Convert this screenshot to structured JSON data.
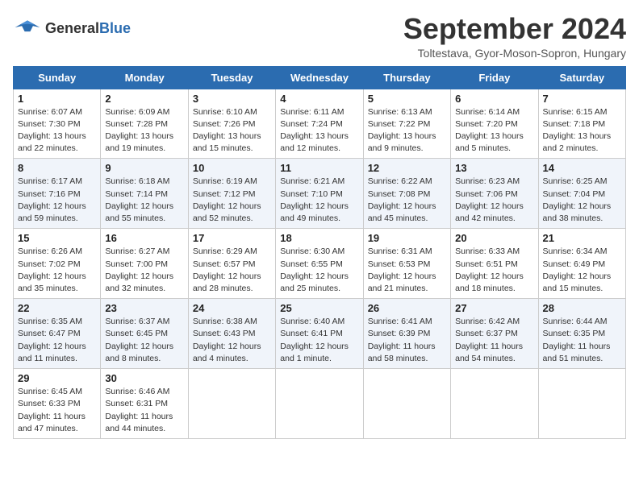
{
  "header": {
    "logo_general": "General",
    "logo_blue": "Blue",
    "month": "September 2024",
    "location": "Toltestava, Gyor-Moson-Sopron, Hungary"
  },
  "weekdays": [
    "Sunday",
    "Monday",
    "Tuesday",
    "Wednesday",
    "Thursday",
    "Friday",
    "Saturday"
  ],
  "weeks": [
    [
      {
        "day": "1",
        "sunrise": "Sunrise: 6:07 AM",
        "sunset": "Sunset: 7:30 PM",
        "daylight": "Daylight: 13 hours and 22 minutes."
      },
      {
        "day": "2",
        "sunrise": "Sunrise: 6:09 AM",
        "sunset": "Sunset: 7:28 PM",
        "daylight": "Daylight: 13 hours and 19 minutes."
      },
      {
        "day": "3",
        "sunrise": "Sunrise: 6:10 AM",
        "sunset": "Sunset: 7:26 PM",
        "daylight": "Daylight: 13 hours and 15 minutes."
      },
      {
        "day": "4",
        "sunrise": "Sunrise: 6:11 AM",
        "sunset": "Sunset: 7:24 PM",
        "daylight": "Daylight: 13 hours and 12 minutes."
      },
      {
        "day": "5",
        "sunrise": "Sunrise: 6:13 AM",
        "sunset": "Sunset: 7:22 PM",
        "daylight": "Daylight: 13 hours and 9 minutes."
      },
      {
        "day": "6",
        "sunrise": "Sunrise: 6:14 AM",
        "sunset": "Sunset: 7:20 PM",
        "daylight": "Daylight: 13 hours and 5 minutes."
      },
      {
        "day": "7",
        "sunrise": "Sunrise: 6:15 AM",
        "sunset": "Sunset: 7:18 PM",
        "daylight": "Daylight: 13 hours and 2 minutes."
      }
    ],
    [
      {
        "day": "8",
        "sunrise": "Sunrise: 6:17 AM",
        "sunset": "Sunset: 7:16 PM",
        "daylight": "Daylight: 12 hours and 59 minutes."
      },
      {
        "day": "9",
        "sunrise": "Sunrise: 6:18 AM",
        "sunset": "Sunset: 7:14 PM",
        "daylight": "Daylight: 12 hours and 55 minutes."
      },
      {
        "day": "10",
        "sunrise": "Sunrise: 6:19 AM",
        "sunset": "Sunset: 7:12 PM",
        "daylight": "Daylight: 12 hours and 52 minutes."
      },
      {
        "day": "11",
        "sunrise": "Sunrise: 6:21 AM",
        "sunset": "Sunset: 7:10 PM",
        "daylight": "Daylight: 12 hours and 49 minutes."
      },
      {
        "day": "12",
        "sunrise": "Sunrise: 6:22 AM",
        "sunset": "Sunset: 7:08 PM",
        "daylight": "Daylight: 12 hours and 45 minutes."
      },
      {
        "day": "13",
        "sunrise": "Sunrise: 6:23 AM",
        "sunset": "Sunset: 7:06 PM",
        "daylight": "Daylight: 12 hours and 42 minutes."
      },
      {
        "day": "14",
        "sunrise": "Sunrise: 6:25 AM",
        "sunset": "Sunset: 7:04 PM",
        "daylight": "Daylight: 12 hours and 38 minutes."
      }
    ],
    [
      {
        "day": "15",
        "sunrise": "Sunrise: 6:26 AM",
        "sunset": "Sunset: 7:02 PM",
        "daylight": "Daylight: 12 hours and 35 minutes."
      },
      {
        "day": "16",
        "sunrise": "Sunrise: 6:27 AM",
        "sunset": "Sunset: 7:00 PM",
        "daylight": "Daylight: 12 hours and 32 minutes."
      },
      {
        "day": "17",
        "sunrise": "Sunrise: 6:29 AM",
        "sunset": "Sunset: 6:57 PM",
        "daylight": "Daylight: 12 hours and 28 minutes."
      },
      {
        "day": "18",
        "sunrise": "Sunrise: 6:30 AM",
        "sunset": "Sunset: 6:55 PM",
        "daylight": "Daylight: 12 hours and 25 minutes."
      },
      {
        "day": "19",
        "sunrise": "Sunrise: 6:31 AM",
        "sunset": "Sunset: 6:53 PM",
        "daylight": "Daylight: 12 hours and 21 minutes."
      },
      {
        "day": "20",
        "sunrise": "Sunrise: 6:33 AM",
        "sunset": "Sunset: 6:51 PM",
        "daylight": "Daylight: 12 hours and 18 minutes."
      },
      {
        "day": "21",
        "sunrise": "Sunrise: 6:34 AM",
        "sunset": "Sunset: 6:49 PM",
        "daylight": "Daylight: 12 hours and 15 minutes."
      }
    ],
    [
      {
        "day": "22",
        "sunrise": "Sunrise: 6:35 AM",
        "sunset": "Sunset: 6:47 PM",
        "daylight": "Daylight: 12 hours and 11 minutes."
      },
      {
        "day": "23",
        "sunrise": "Sunrise: 6:37 AM",
        "sunset": "Sunset: 6:45 PM",
        "daylight": "Daylight: 12 hours and 8 minutes."
      },
      {
        "day": "24",
        "sunrise": "Sunrise: 6:38 AM",
        "sunset": "Sunset: 6:43 PM",
        "daylight": "Daylight: 12 hours and 4 minutes."
      },
      {
        "day": "25",
        "sunrise": "Sunrise: 6:40 AM",
        "sunset": "Sunset: 6:41 PM",
        "daylight": "Daylight: 12 hours and 1 minute."
      },
      {
        "day": "26",
        "sunrise": "Sunrise: 6:41 AM",
        "sunset": "Sunset: 6:39 PM",
        "daylight": "Daylight: 11 hours and 58 minutes."
      },
      {
        "day": "27",
        "sunrise": "Sunrise: 6:42 AM",
        "sunset": "Sunset: 6:37 PM",
        "daylight": "Daylight: 11 hours and 54 minutes."
      },
      {
        "day": "28",
        "sunrise": "Sunrise: 6:44 AM",
        "sunset": "Sunset: 6:35 PM",
        "daylight": "Daylight: 11 hours and 51 minutes."
      }
    ],
    [
      {
        "day": "29",
        "sunrise": "Sunrise: 6:45 AM",
        "sunset": "Sunset: 6:33 PM",
        "daylight": "Daylight: 11 hours and 47 minutes."
      },
      {
        "day": "30",
        "sunrise": "Sunrise: 6:46 AM",
        "sunset": "Sunset: 6:31 PM",
        "daylight": "Daylight: 11 hours and 44 minutes."
      },
      null,
      null,
      null,
      null,
      null
    ]
  ]
}
